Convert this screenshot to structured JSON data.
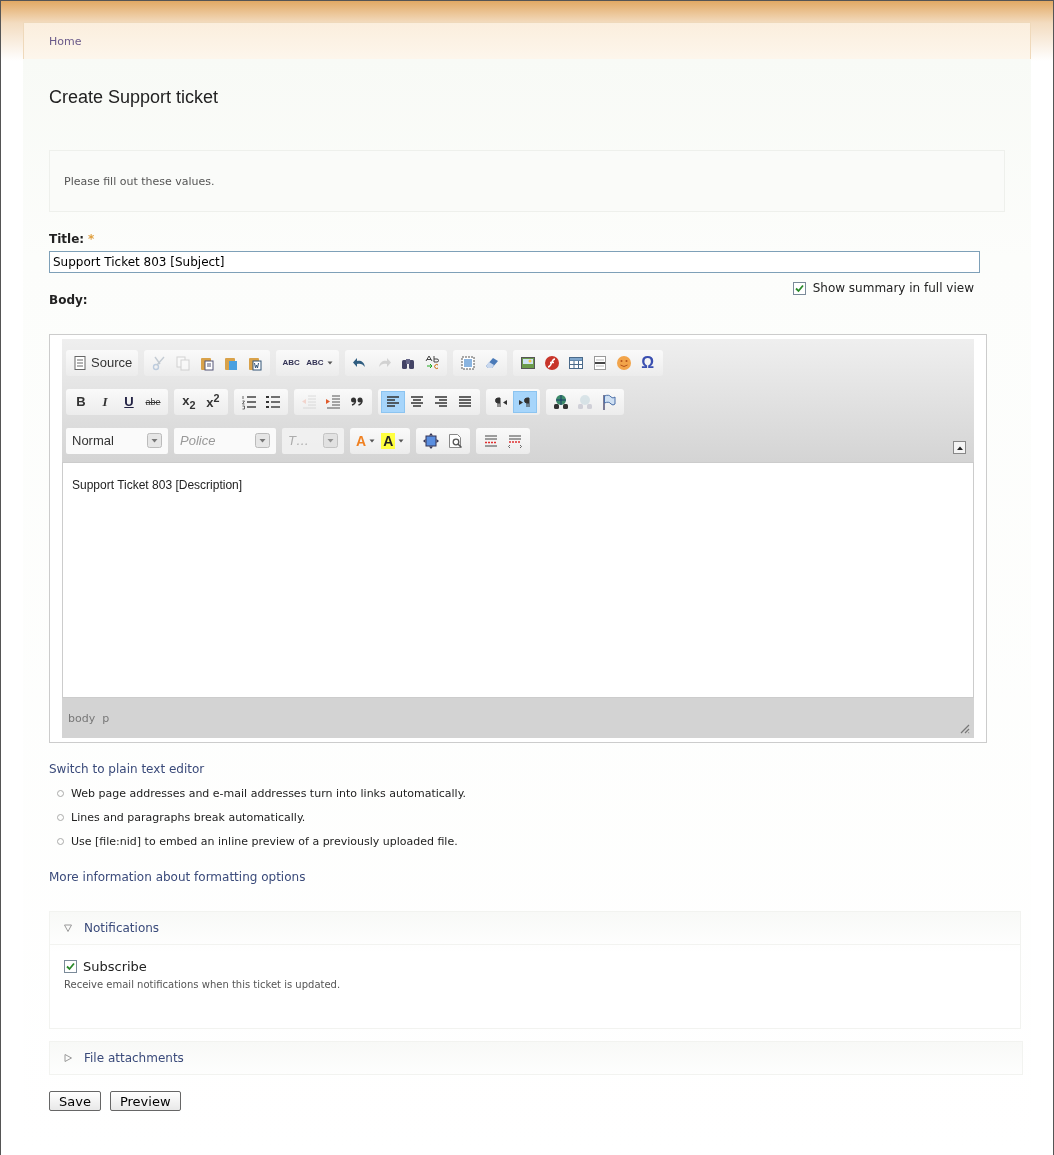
{
  "breadcrumb": [
    "Home"
  ],
  "page_title": "Create Support ticket",
  "message": "Please fill out these values.",
  "title_field": {
    "label": "Title:",
    "required_mark": "*",
    "value": "Support Ticket 803 [Subject]"
  },
  "summary_toggle": {
    "label": "Show summary in full view",
    "checked": true
  },
  "body_label": "Body:",
  "toolbar": {
    "rows": [
      {
        "groups": [
          {
            "kind": "buttons",
            "buttons": [
              {
                "kind": "source",
                "label": "Source",
                "caret": false,
                "selected": false,
                "disabled": false
              }
            ]
          },
          {
            "kind": "buttons",
            "buttons": [
              {
                "kind": "icon",
                "caret": false,
                "selected": false,
                "disabled": true
              },
              {
                "kind": "icon",
                "caret": false,
                "selected": false,
                "disabled": true
              },
              {
                "kind": "icon",
                "caret": false,
                "selected": false,
                "disabled": false
              },
              {
                "kind": "icon",
                "caret": false,
                "selected": false,
                "disabled": false
              },
              {
                "kind": "icon",
                "caret": false,
                "selected": false,
                "disabled": false
              }
            ]
          },
          {
            "kind": "buttons",
            "buttons": [
              {
                "kind": "spell",
                "label": "ABC",
                "caret": false,
                "selected": false,
                "disabled": false
              },
              {
                "kind": "spell",
                "label": "ABC",
                "caret": true,
                "selected": false,
                "disabled": false
              }
            ]
          },
          {
            "kind": "buttons",
            "buttons": [
              {
                "kind": "icon",
                "caret": false,
                "selected": false,
                "disabled": false
              },
              {
                "kind": "icon",
                "caret": false,
                "selected": false,
                "disabled": true
              },
              {
                "kind": "icon",
                "caret": false,
                "selected": false,
                "disabled": false
              },
              {
                "kind": "icon",
                "caret": false,
                "selected": false,
                "disabled": false
              }
            ]
          },
          {
            "kind": "buttons",
            "buttons": [
              {
                "kind": "icon",
                "caret": false,
                "selected": false,
                "disabled": false
              },
              {
                "kind": "icon",
                "caret": false,
                "selected": false,
                "disabled": false
              }
            ]
          },
          {
            "kind": "buttons",
            "buttons": [
              {
                "kind": "icon",
                "caret": false,
                "selected": false,
                "disabled": false
              },
              {
                "kind": "icon",
                "caret": false,
                "selected": false,
                "disabled": false
              },
              {
                "kind": "icon",
                "caret": false,
                "selected": false,
                "disabled": false
              },
              {
                "kind": "icon",
                "caret": false,
                "selected": false,
                "disabled": false
              },
              {
                "kind": "icon",
                "caret": false,
                "selected": false,
                "disabled": false
              },
              {
                "kind": "text",
                "label": "Ω",
                "caret": false,
                "selected": false,
                "disabled": false
              }
            ]
          }
        ]
      },
      {
        "groups": [
          {
            "kind": "buttons",
            "buttons": [
              {
                "kind": "bold",
                "label": "B",
                "caret": false,
                "selected": false,
                "disabled": false
              },
              {
                "kind": "italic",
                "label": "I",
                "caret": false,
                "selected": false,
                "disabled": false
              },
              {
                "kind": "underline",
                "label": "U",
                "caret": false,
                "selected": false,
                "disabled": false
              },
              {
                "kind": "strike",
                "label": "abe",
                "caret": false,
                "selected": false,
                "disabled": false
              }
            ]
          },
          {
            "kind": "buttons",
            "buttons": [
              {
                "kind": "bold",
                "label": "x$_{2}$",
                "caret": false,
                "selected": false,
                "disabled": false
              },
              {
                "kind": "bold",
                "label": "x$^{2}$",
                "caret": false,
                "selected": false,
                "disabled": false
              }
            ]
          },
          {
            "kind": "buttons",
            "buttons": [
              {
                "kind": "icon",
                "caret": false,
                "selected": false,
                "disabled": false
              },
              {
                "kind": "icon",
                "caret": false,
                "selected": false,
                "disabled": false
              }
            ]
          },
          {
            "kind": "buttons",
            "buttons": [
              {
                "kind": "icon",
                "caret": false,
                "selected": false,
                "disabled": true
              },
              {
                "kind": "icon",
                "caret": false,
                "selected": false,
                "disabled": false
              },
              {
                "kind": "icon",
                "caret": false,
                "selected": false,
                "disabled": false
              }
            ]
          },
          {
            "kind": "buttons",
            "buttons": [
              {
                "kind": "icon",
                "caret": false,
                "selected": true,
                "disabled": false
              },
              {
                "kind": "icon",
                "caret": false,
                "selected": false,
                "disabled": false
              },
              {
                "kind": "icon",
                "caret": false,
                "selected": false,
                "disabled": false
              },
              {
                "kind": "icon",
                "caret": false,
                "selected": false,
                "disabled": false
              }
            ]
          },
          {
            "kind": "buttons",
            "buttons": [
              {
                "kind": "icon",
                "caret": false,
                "selected": false,
                "disabled": false
              },
              {
                "kind": "icon",
                "caret": false,
                "selected": true,
                "disabled": false
              }
            ]
          },
          {
            "kind": "buttons",
            "buttons": [
              {
                "kind": "icon",
                "caret": false,
                "selected": false,
                "disabled": false
              },
              {
                "kind": "icon",
                "caret": false,
                "selected": false,
                "disabled": true
              },
              {
                "kind": "icon",
                "caret": false,
                "selected": false,
                "disabled": false
              }
            ]
          }
        ]
      },
      {
        "groups": [
          {
            "kind": "combo",
            "value": "Normal",
            "disabled": false
          },
          {
            "kind": "combo",
            "placeholder": "Police",
            "disabled": false
          },
          {
            "kind": "combo",
            "placeholder": "T…",
            "disabled": true
          },
          {
            "kind": "buttons",
            "buttons": [
              {
                "kind": "forecolor",
                "label": "A",
                "caret": true,
                "selected": false,
                "disabled": false
              },
              {
                "kind": "backcolor",
                "label": "A",
                "caret": true,
                "selected": false,
                "disabled": false
              }
            ]
          },
          {
            "kind": "buttons",
            "buttons": [
              {
                "kind": "icon",
                "caret": false,
                "selected": false,
                "disabled": false
              },
              {
                "kind": "icon",
                "caret": false,
                "selected": false,
                "disabled": false
              }
            ]
          },
          {
            "kind": "buttons",
            "buttons": [
              {
                "kind": "icon",
                "caret": false,
                "selected": false,
                "disabled": false
              },
              {
                "kind": "icon",
                "caret": false,
                "selected": false,
                "disabled": false
              }
            ]
          }
        ]
      }
    ]
  },
  "editor_content": "Support Ticket 803 [Description]",
  "editor_path": [
    "body",
    "p"
  ],
  "switch_link": "Switch to plain text editor",
  "format_tips": [
    "Web page addresses and e-mail addresses turn into links automatically.",
    "Lines and paragraphs break automatically.",
    "Use [file:nid] to embed an inline preview of a previously uploaded file."
  ],
  "more_info_link": "More information about formatting options",
  "fieldsets": [
    {
      "legend": "Notifications",
      "expanded": true,
      "checkbox": {
        "label": "Subscribe",
        "checked": true
      },
      "description": "Receive email notifications when this ticket is updated."
    },
    {
      "legend": "File attachments",
      "expanded": false
    }
  ],
  "buttons": [
    "Save",
    "Preview"
  ]
}
